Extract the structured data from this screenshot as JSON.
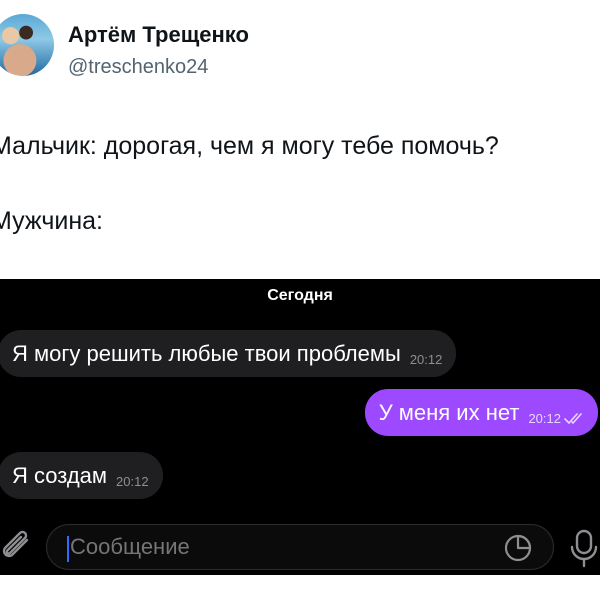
{
  "tweet": {
    "author_name": "Артём Трещенко",
    "handle": "@treschenko24",
    "line1": "Мальчик: дорогая, чем я могу тебе помочь?",
    "line2": "Мужчина:"
  },
  "chat": {
    "date_label": "Сегодня",
    "messages": [
      {
        "direction": "incoming",
        "text": "Я могу решить любые твои проблемы",
        "time": "20:12"
      },
      {
        "direction": "outgoing",
        "text": "У меня их нет",
        "time": "20:12",
        "status": "read"
      },
      {
        "direction": "incoming",
        "text": "Я создам",
        "time": "20:12"
      }
    ],
    "input": {
      "placeholder": "Сообщение"
    },
    "icons": {
      "attach": "paperclip-icon",
      "sticker": "sticker-icon",
      "mic": "microphone-icon",
      "read_status": "double-check-icon"
    },
    "colors": {
      "background": "#000000",
      "incoming_bubble": "#1f1f21",
      "outgoing_bubble": "#9d49ff"
    }
  }
}
